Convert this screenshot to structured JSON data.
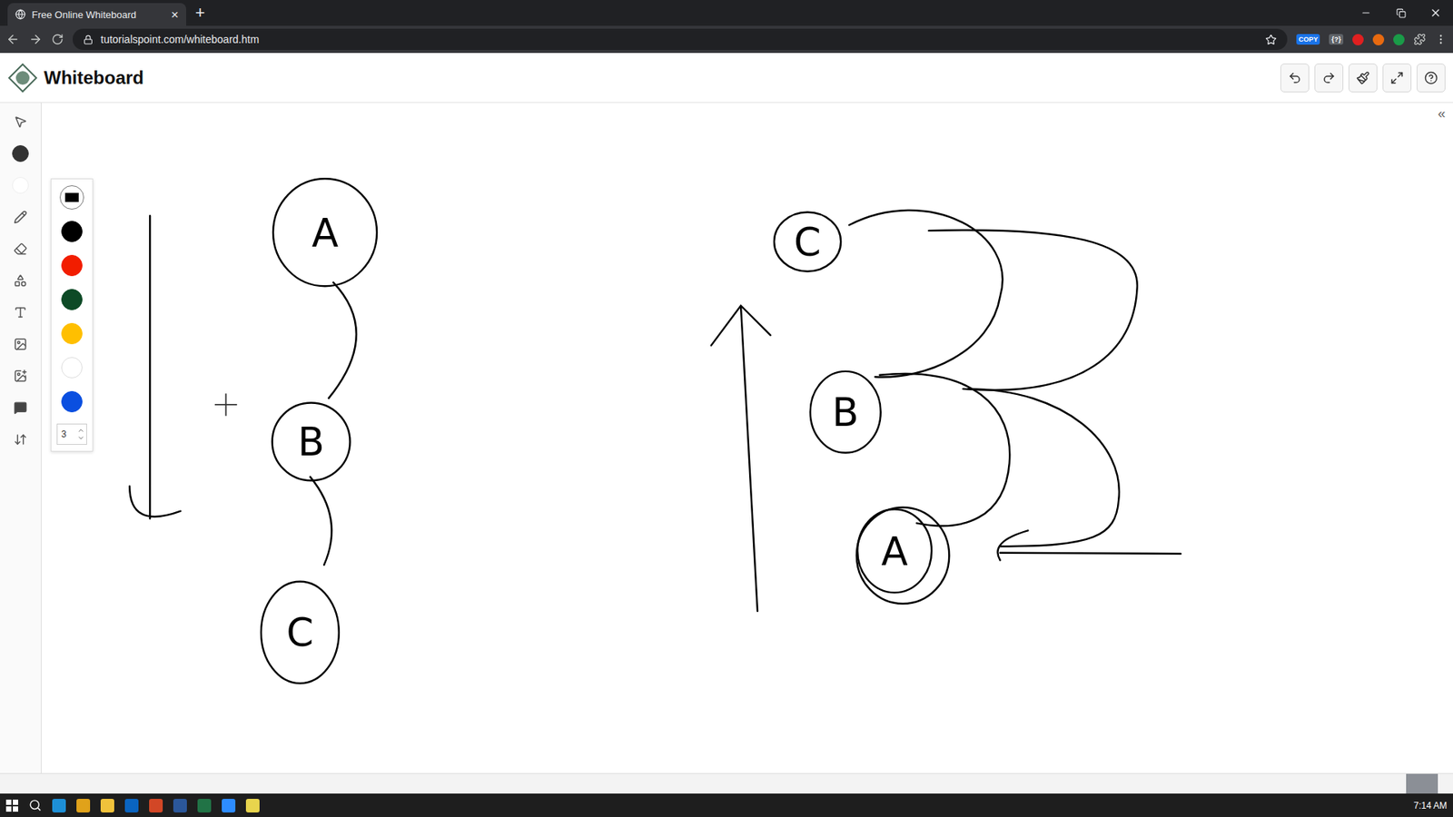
{
  "browser": {
    "tab_title": "Free Online Whiteboard",
    "tab_close": "×",
    "new_tab": "+",
    "url": "tutorialspoint.com/whiteboard.htm",
    "extensions": [
      "COPY",
      "{?}"
    ]
  },
  "app": {
    "title": "Whiteboard",
    "collapse": "«"
  },
  "palette": {
    "colors": [
      {
        "kind": "swatch",
        "color": "#000000",
        "selected": true
      },
      {
        "kind": "dot",
        "color": "#000000",
        "selected": false
      },
      {
        "kind": "dot",
        "color": "#f21d00",
        "selected": false
      },
      {
        "kind": "dot",
        "color": "#0d4a26",
        "selected": false
      },
      {
        "kind": "dot",
        "color": "#ffbf00",
        "selected": false
      },
      {
        "kind": "dot",
        "color": "#ffffff",
        "selected": false
      },
      {
        "kind": "dot",
        "color": "#0a4fe0",
        "selected": false
      }
    ],
    "stroke_width": "3"
  },
  "diagram": {
    "left": {
      "nodes": [
        {
          "label": "A",
          "double": false
        },
        {
          "label": "B",
          "double": false
        },
        {
          "label": "C",
          "double": false
        }
      ]
    },
    "right": {
      "nodes": [
        {
          "label": "C",
          "double": false
        },
        {
          "label": "B",
          "double": false
        },
        {
          "label": "A",
          "double": true
        }
      ]
    }
  },
  "taskbar": {
    "time": "7:14 AM"
  }
}
